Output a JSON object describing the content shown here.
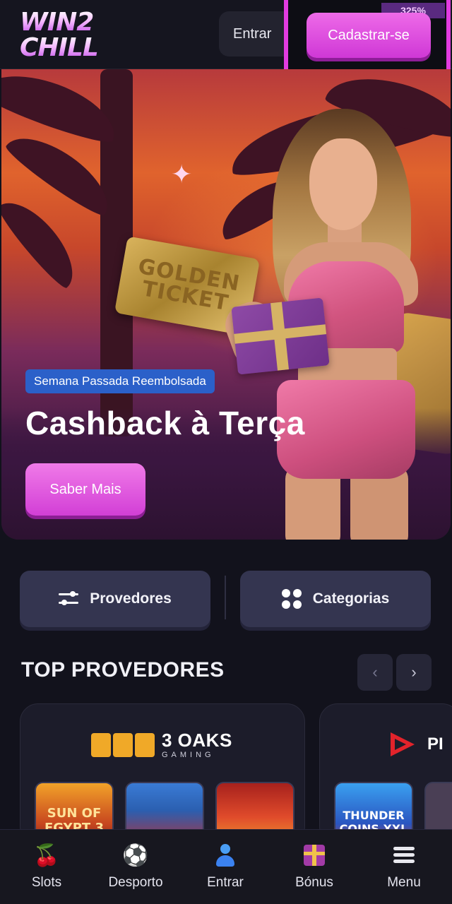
{
  "header": {
    "logo_line1": "WIN2",
    "logo_line2": "CHILL",
    "login_label": "Entrar",
    "signup_label": "Cadastrar-se",
    "signup_badge": "325%"
  },
  "banner": {
    "ticket_text": "GOLDEN TICKET",
    "badge": "Semana Passada Reembolsada",
    "headline": "Cashback à Terça",
    "cta_label": "Saber Mais"
  },
  "filters": {
    "providers_label": "Provedores",
    "categories_label": "Categorias"
  },
  "top_providers": {
    "title": "TOP PROVEDORES",
    "prev_icon": "chevron-left-icon",
    "next_icon": "chevron-right-icon",
    "cards": [
      {
        "provider_name": "3 OAKS",
        "provider_sub": "GAMING",
        "games": [
          "SUN OF EGYPT 3",
          "",
          ""
        ]
      },
      {
        "provider_name": "PI",
        "games": [
          "THUNDER COINS XXL",
          ""
        ]
      }
    ]
  },
  "bottom_nav": {
    "items": [
      {
        "label": "Slots",
        "icon": "cherry-icon"
      },
      {
        "label": "Desporto",
        "icon": "soccer-ball-icon"
      },
      {
        "label": "Entrar",
        "icon": "user-icon"
      },
      {
        "label": "Bónus",
        "icon": "gift-icon"
      },
      {
        "label": "Menu",
        "icon": "menu-icon"
      }
    ]
  },
  "colors": {
    "accent_pink": "#d23fd6",
    "badge_blue": "#2b60c9",
    "background": "#12121c"
  }
}
